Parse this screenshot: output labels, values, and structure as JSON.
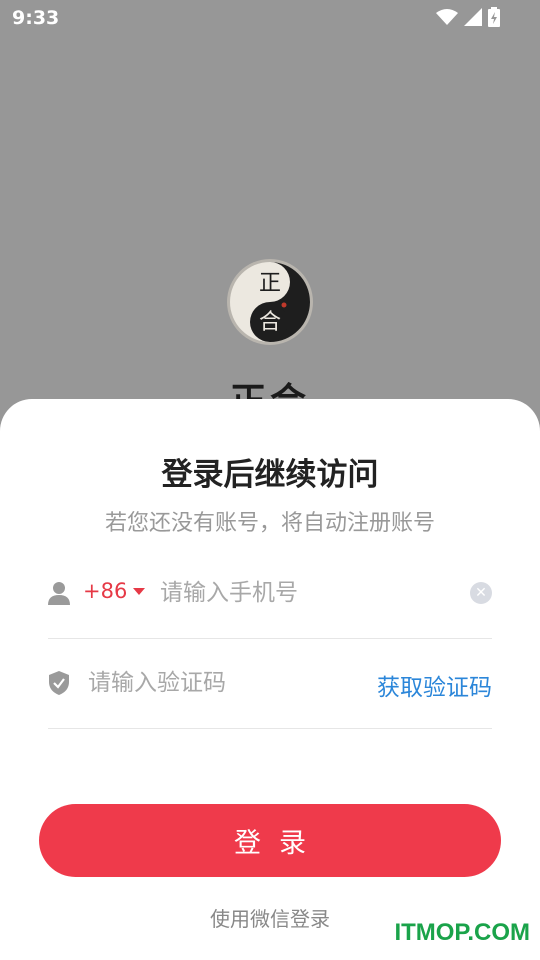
{
  "status_bar": {
    "time": "9:33"
  },
  "app": {
    "logo_top_char": "正",
    "logo_bottom_char": "合",
    "name": "正合"
  },
  "sheet": {
    "title": "登录后继续访问",
    "subtitle": "若您还没有账号，将自动注册账号"
  },
  "phone_row": {
    "country_code": "+86",
    "placeholder": "请输入手机号",
    "value": ""
  },
  "code_row": {
    "placeholder": "请输入验证码",
    "value": "",
    "get_code_label": "获取验证码"
  },
  "login_button": {
    "label": "登录"
  },
  "wechat_login": {
    "label": "使用微信登录"
  },
  "watermark": {
    "text": "ITMOP.COM"
  },
  "colors": {
    "accent": "#ef3a4b",
    "link": "#2b86d9",
    "overlay": "#979797"
  }
}
